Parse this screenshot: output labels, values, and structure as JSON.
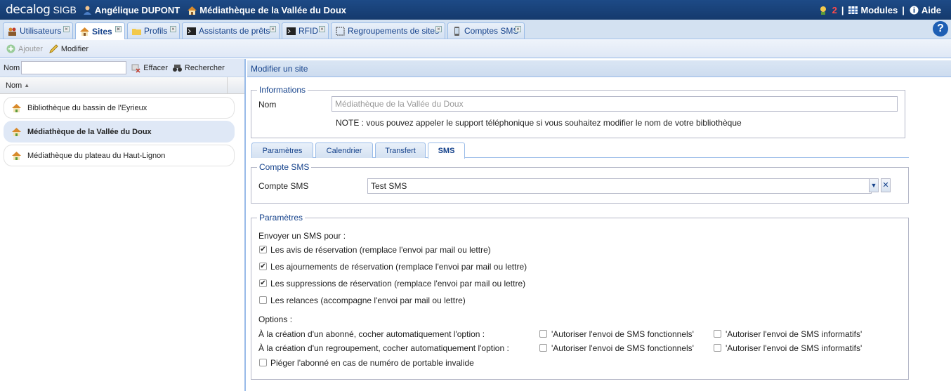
{
  "topbar": {
    "logo": "decalog",
    "product": "SIGB",
    "user": "Angélique DUPONT",
    "library": "Médiathèque de la Vallée du Doux",
    "notif_count": "2",
    "modules": "Modules",
    "help": "Aide"
  },
  "tabs": [
    {
      "label": "Utilisateurs"
    },
    {
      "label": "Sites"
    },
    {
      "label": "Profils"
    },
    {
      "label": "Assistants de prêts"
    },
    {
      "label": "RFID"
    },
    {
      "label": "Regroupements de sites"
    },
    {
      "label": "Comptes SMS"
    }
  ],
  "help_button": "?",
  "toolbar": {
    "add": "Ajouter",
    "edit": "Modifier"
  },
  "list": {
    "search_label": "Nom",
    "search_value": "",
    "clear": "Effacer",
    "search": "Rechercher",
    "column": "Nom",
    "items": [
      "Bibliothèque du bassin de l'Eyrieux",
      "Médiathèque de la Vallée du Doux",
      "Médiathèque du plateau du Haut-Lignon"
    ]
  },
  "form": {
    "title": "Modifier un site",
    "info_legend": "Informations",
    "name_label": "Nom",
    "name_value": "Médiathèque de la Vallée du Doux",
    "note": "NOTE : vous pouvez appeler le support téléphonique si vous souhaitez modifier le nom de votre bibliothèque",
    "subtabs": [
      "Paramètres",
      "Calendrier",
      "Transfert",
      "SMS"
    ],
    "sms_legend": "Compte SMS",
    "sms_label": "Compte SMS",
    "sms_value": "Test SMS",
    "params_legend": "Paramètres",
    "send_label": "Envoyer un SMS pour :",
    "checks": [
      {
        "label": "Les avis de réservation (remplace l'envoi par mail ou lettre)",
        "checked": true
      },
      {
        "label": "Les ajournements de réservation (remplace l'envoi par mail ou lettre)",
        "checked": true
      },
      {
        "label": "Les suppressions de réservation (remplace l'envoi par mail ou lettre)",
        "checked": true
      },
      {
        "label": "Les relances (accompagne l'envoi par mail ou lettre)",
        "checked": false
      }
    ],
    "options_label": "Options :",
    "opt_row1": "À la création d'un abonné, cocher automatiquement l'option :",
    "opt_row2": "À la création d'un regroupement, cocher automatiquement l'option :",
    "opt_func": "'Autoriser l'envoi de SMS fonctionnels'",
    "opt_info": "'Autoriser l'envoi de SMS informatifs'",
    "trap": "Piéger l'abonné en cas de numéro de portable invalide"
  }
}
